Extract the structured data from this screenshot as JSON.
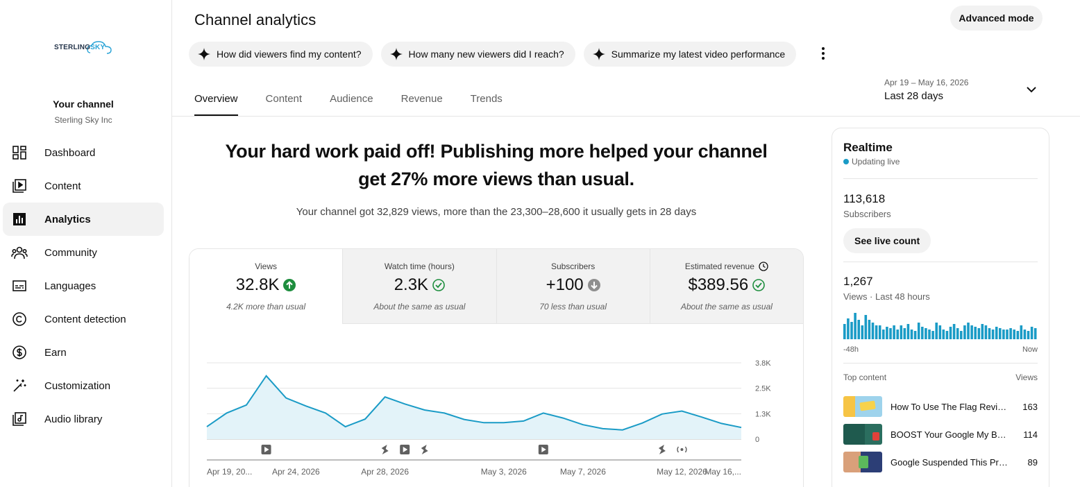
{
  "sidebar": {
    "logo_prefix": "STERLING",
    "logo_suffix": "SKY",
    "channel_title": "Your channel",
    "channel_name": "Sterling Sky Inc",
    "items": [
      {
        "label": "Dashboard",
        "icon": "dashboard-icon"
      },
      {
        "label": "Content",
        "icon": "content-icon"
      },
      {
        "label": "Analytics",
        "icon": "analytics-icon",
        "active": true
      },
      {
        "label": "Community",
        "icon": "community-icon"
      },
      {
        "label": "Languages",
        "icon": "languages-icon"
      },
      {
        "label": "Content detection",
        "icon": "copyright-icon"
      },
      {
        "label": "Earn",
        "icon": "dollar-icon"
      },
      {
        "label": "Customization",
        "icon": "magic-wand-icon"
      },
      {
        "label": "Audio library",
        "icon": "audio-library-icon"
      }
    ]
  },
  "header": {
    "title": "Channel analytics",
    "advanced_mode": "Advanced mode",
    "chips": [
      "How did viewers find my content?",
      "How many new viewers did I reach?",
      "Summarize my latest video performance"
    ],
    "tabs": [
      "Overview",
      "Content",
      "Audience",
      "Revenue",
      "Trends"
    ],
    "active_tab": "Overview",
    "date_range": "Apr 19 – May 16, 2026",
    "date_label": "Last 28 days"
  },
  "hero": {
    "headline_line1": "Your hard work paid off! Publishing more helped your channel",
    "headline_line2": "get 27% more views than usual.",
    "subtitle": "Your channel got 32,829 views, more than the 23,300–28,600 it usually gets in 28 days"
  },
  "metrics": [
    {
      "label": "Views",
      "value": "32.8K",
      "status": "up",
      "note": "4.2K more than usual"
    },
    {
      "label": "Watch time (hours)",
      "value": "2.3K",
      "status": "ok",
      "note": "About the same as usual"
    },
    {
      "label": "Subscribers",
      "value": "+100",
      "status": "down",
      "note": "70 less than usual"
    },
    {
      "label": "Estimated revenue",
      "value": "$389.56",
      "status": "ok",
      "note": "About the same as usual",
      "has_clock": true
    }
  ],
  "colors": {
    "accent": "#1a9bc6",
    "area_fill": "#e3f3f9",
    "up_green": "#1e8e3e",
    "down_grey": "#8f8f8f"
  },
  "chart_data": {
    "type": "area",
    "title": "",
    "xlabel": "",
    "ylabel": "",
    "x_tick_labels": [
      "Apr 19, 20...",
      "Apr 24, 2026",
      "Apr 28, 2026",
      "May 3, 2026",
      "May 7, 2026",
      "May 12, 2026",
      "May 16,..."
    ],
    "y_tick_labels": [
      "3.8K",
      "2.5K",
      "1.3K",
      "0"
    ],
    "ylim": [
      0,
      3800
    ],
    "grid": true,
    "series": [
      {
        "values": [
          620,
          1300,
          1700,
          3150,
          2050,
          1650,
          1300,
          620,
          1000,
          2100,
          1750,
          1450,
          1300,
          980,
          820,
          820,
          900,
          1300,
          1050,
          720,
          520,
          460,
          800,
          1250,
          1400,
          1100,
          780,
          580
        ]
      }
    ],
    "markers": [
      {
        "day": 3,
        "type": "video"
      },
      {
        "day": 9,
        "type": "short"
      },
      {
        "day": 10,
        "type": "video"
      },
      {
        "day": 11,
        "type": "short"
      },
      {
        "day": 17,
        "type": "video"
      },
      {
        "day": 23,
        "type": "short"
      },
      {
        "day": 24,
        "type": "live"
      }
    ]
  },
  "realtime": {
    "title": "Realtime",
    "status": "Updating live",
    "subscribers_value": "113,618",
    "subscribers_label": "Subscribers",
    "see_live": "See live count",
    "views_value": "1,267",
    "views_label": "Views · Last 48 hours",
    "axis_start": "-48h",
    "axis_end": "Now",
    "bars": [
      22,
      30,
      25,
      38,
      28,
      20,
      35,
      28,
      24,
      20,
      20,
      14,
      18,
      16,
      20,
      14,
      20,
      16,
      22,
      14,
      12,
      24,
      18,
      16,
      14,
      12,
      24,
      20,
      14,
      12,
      18,
      22,
      16,
      12,
      20,
      24,
      20,
      18,
      16,
      22,
      20,
      16,
      14,
      18,
      16,
      14,
      14,
      16,
      14,
      12,
      20,
      14,
      12,
      18,
      16
    ],
    "bars_alt": [
      18,
      26,
      22,
      32,
      24,
      18,
      28,
      22,
      20,
      18,
      16,
      12,
      14,
      14,
      16,
      12,
      16,
      14,
      18,
      12,
      10,
      20,
      14,
      14,
      12,
      10,
      20,
      16,
      12,
      10,
      14,
      18,
      14,
      10,
      16,
      20,
      16,
      14,
      12,
      18,
      16,
      14,
      12,
      14,
      12,
      12,
      12,
      14,
      12,
      10,
      16,
      12,
      10,
      14,
      12
    ],
    "top_content_label": "Top content",
    "views_col": "Views",
    "top_content": [
      {
        "title": "How To Use The Flag Revie...",
        "views": "163"
      },
      {
        "title": "BOOST Your Google My Bu...",
        "views": "114"
      },
      {
        "title": "Google Suspended This Pro...",
        "views": "89"
      }
    ]
  }
}
